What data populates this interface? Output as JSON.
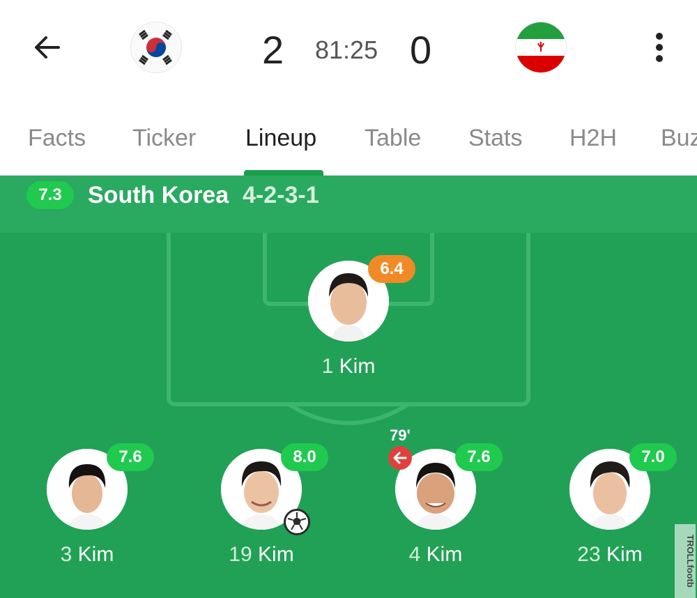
{
  "match": {
    "home_flag": "south-korea-flag",
    "away_flag": "iran-flag",
    "home_score": "2",
    "away_score": "0",
    "clock": "81:25"
  },
  "tabs": [
    {
      "label": "Facts",
      "active": false
    },
    {
      "label": "Ticker",
      "active": false
    },
    {
      "label": "Lineup",
      "active": true
    },
    {
      "label": "Table",
      "active": false
    },
    {
      "label": "Stats",
      "active": false
    },
    {
      "label": "H2H",
      "active": false
    },
    {
      "label": "Buz",
      "active": false
    }
  ],
  "team": {
    "rating": "7.3",
    "name": "South Korea",
    "formation": "4-2-3-1"
  },
  "players": [
    {
      "number": "1",
      "name": "Kim",
      "rating": "6.4",
      "rating_color": "orange"
    },
    {
      "number": "3",
      "name": "Kim",
      "rating": "7.6",
      "rating_color": "green"
    },
    {
      "number": "19",
      "name": "Kim",
      "rating": "8.0",
      "rating_color": "green",
      "event_icon": "goal-ball-icon"
    },
    {
      "number": "4",
      "name": "Kim",
      "rating": "7.6",
      "rating_color": "green",
      "event_icon": "substitution-out-icon",
      "sub_minute": "79'"
    },
    {
      "number": "23",
      "name": "Kim",
      "rating": "7.0",
      "rating_color": "green"
    }
  ],
  "watermark": "TROLLfootb",
  "colors": {
    "accent": "#1a9e4b",
    "pitch": "#21a156",
    "rating_green": "#1fca4f",
    "rating_orange": "#f18a26",
    "sub_red": "#e0413d"
  }
}
